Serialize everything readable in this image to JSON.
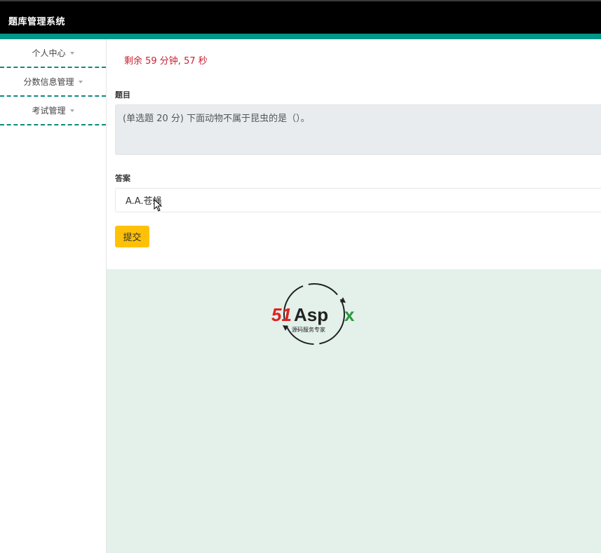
{
  "header": {
    "title": "题库管理系统",
    "accent_color": "#009688"
  },
  "sidebar": {
    "items": [
      {
        "label": "个人中心"
      },
      {
        "label": "分数信息管理"
      },
      {
        "label": "考试管理"
      }
    ]
  },
  "exam": {
    "timer_text": "剩余 59 分钟, 57 秒",
    "question_label": "题目",
    "question_text": "(单选题 20 分) 下面动物不属于昆虫的是（）。",
    "answer_label": "答案",
    "answer_value": "A.A.苍蝇",
    "submit_label": "提交"
  },
  "watermark": {
    "brand": "51Aspx",
    "tagline": "源码服务专家"
  }
}
